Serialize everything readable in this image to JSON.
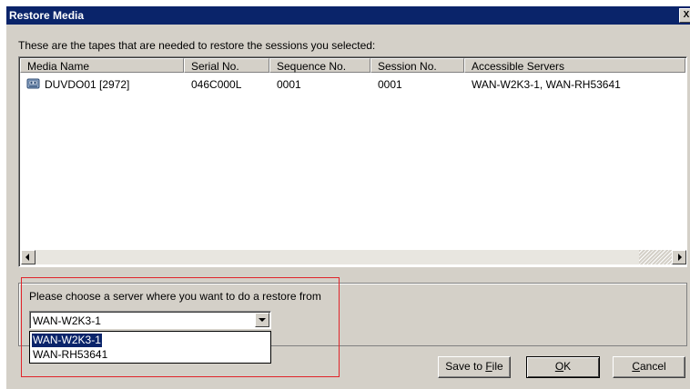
{
  "window": {
    "title": "Restore Media",
    "close_glyph": "X"
  },
  "intro": "These are the tapes that are needed to restore the sessions you selected:",
  "media_list": {
    "columns": [
      "Media Name",
      "Serial No.",
      "Sequence No.",
      "Session No.",
      "Accessible Servers"
    ],
    "rows": [
      {
        "icon": "tape-drive-icon",
        "media_name": "DUVDO01 [2972]",
        "serial_no": "046C000L",
        "sequence_no": "0001",
        "session_no": "0001",
        "accessible_servers": "WAN-W2K3-1, WAN-RH53641"
      }
    ]
  },
  "server_group": {
    "prompt": "Please choose a server where you want to do a restore from",
    "selected": "WAN-W2K3-1",
    "options": [
      "WAN-W2K3-1",
      "WAN-RH53641"
    ]
  },
  "buttons": {
    "save_to_file_prefix": "Save to ",
    "save_to_file_key": "F",
    "save_to_file_suffix": "ile",
    "ok_key": "O",
    "ok_suffix": "K",
    "cancel_key": "C",
    "cancel_suffix": "ancel"
  },
  "colors": {
    "title_bar": "#0a246a",
    "dialog_face": "#d4d0c8",
    "highlight_box": "#e0242a"
  }
}
